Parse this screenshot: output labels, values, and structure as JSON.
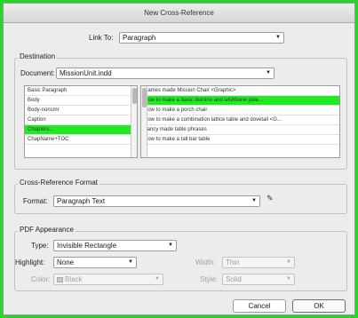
{
  "window": {
    "title": "New Cross-Reference"
  },
  "link_to": {
    "label": "Link To:",
    "value": "Paragraph"
  },
  "destination": {
    "group_label": "Destination",
    "document_label": "Document:",
    "document_value": "MissionUnit.indd",
    "styles": [
      "Basic Paragraph",
      "Body",
      "Body-nonsmr",
      "Caption",
      "Chapters...",
      "ChapName+TOC"
    ],
    "styles_selected_index": 4,
    "paragraphs": [
      "Names made Mission Chair <Graphic>",
      "How to make a basic domino and wishbone pole...",
      "How to make a porch chair",
      "How to make a combination lattice table and dovetail <G...",
      "Fancy made table phrases",
      "How to make a tall bar table"
    ],
    "paragraphs_selected_index": 1
  },
  "format_section": {
    "group_label": "Cross-Reference Format",
    "format_label": "Format:",
    "format_value": "Paragraph Text",
    "edit_icon": "pencil-icon"
  },
  "pdf": {
    "group_label": "PDF Appearance",
    "type_label": "Type:",
    "type_value": "Invisible Rectangle",
    "highlight_label": "Highlight:",
    "highlight_value": "None",
    "width_label": "Width:",
    "width_value": "Thin",
    "color_label": "Color:",
    "color_value": "Black",
    "style_label": "Style:",
    "style_value": "Solid"
  },
  "buttons": {
    "cancel": "Cancel",
    "ok": "OK"
  },
  "colors": {
    "highlight": "#22ea22",
    "frame": "#26d626"
  }
}
